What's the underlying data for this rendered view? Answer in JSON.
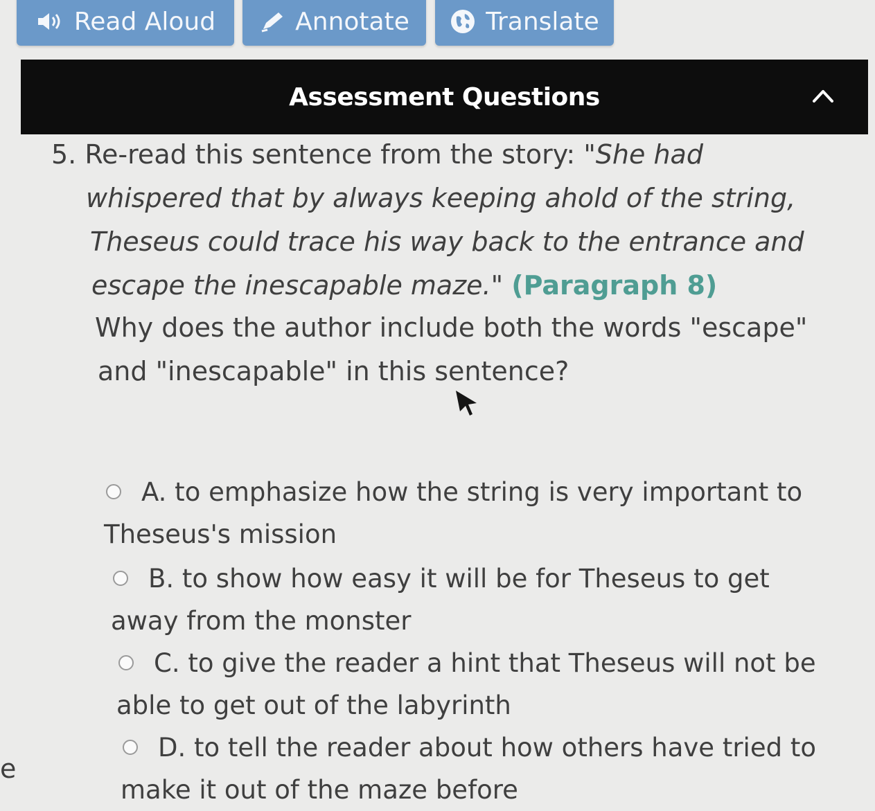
{
  "toolbar": {
    "read_aloud": {
      "label": "Read Aloud",
      "icon": "speaker-icon"
    },
    "annotate": {
      "label": "Annotate",
      "icon": "pencil-icon"
    },
    "translate": {
      "label": "Translate",
      "icon": "globe-icon"
    },
    "button_color": "#6b99c9"
  },
  "section": {
    "title": "Assessment Questions",
    "collapse_icon": "chevron-up-icon",
    "header_color": "#0d0d0d"
  },
  "question": {
    "number": "5.",
    "intro": "Re-read this sentence from the story: ",
    "quote_line1": "\"She had",
    "quote_line2": "whispered that by always keeping ahold of the string,",
    "quote_line3": "Theseus could trace his way back to the entrance and",
    "quote_line4": "escape the inescapable maze.\"",
    "paragraph_ref": "(Paragraph 8)",
    "prompt_line1": "Why does the author include both the words \"escape\"",
    "prompt_line2": "and \"inescapable\" in this sentence?",
    "reference_color": "#4f9d93"
  },
  "options": [
    {
      "first": "A. to emphasize how the string is very important to",
      "rest": "Theseus's mission",
      "selected": false
    },
    {
      "first": "B. to show how easy it will be for Theseus to get",
      "rest": "away from the monster",
      "selected": false
    },
    {
      "first": "C. to give the reader a hint that Theseus will not be",
      "rest": "able to get out of the labyrinth",
      "selected": false
    },
    {
      "first": "D. to tell the reader about how others have tried to",
      "rest": "make it out of the maze before",
      "selected": false
    }
  ],
  "edge_text": "e"
}
